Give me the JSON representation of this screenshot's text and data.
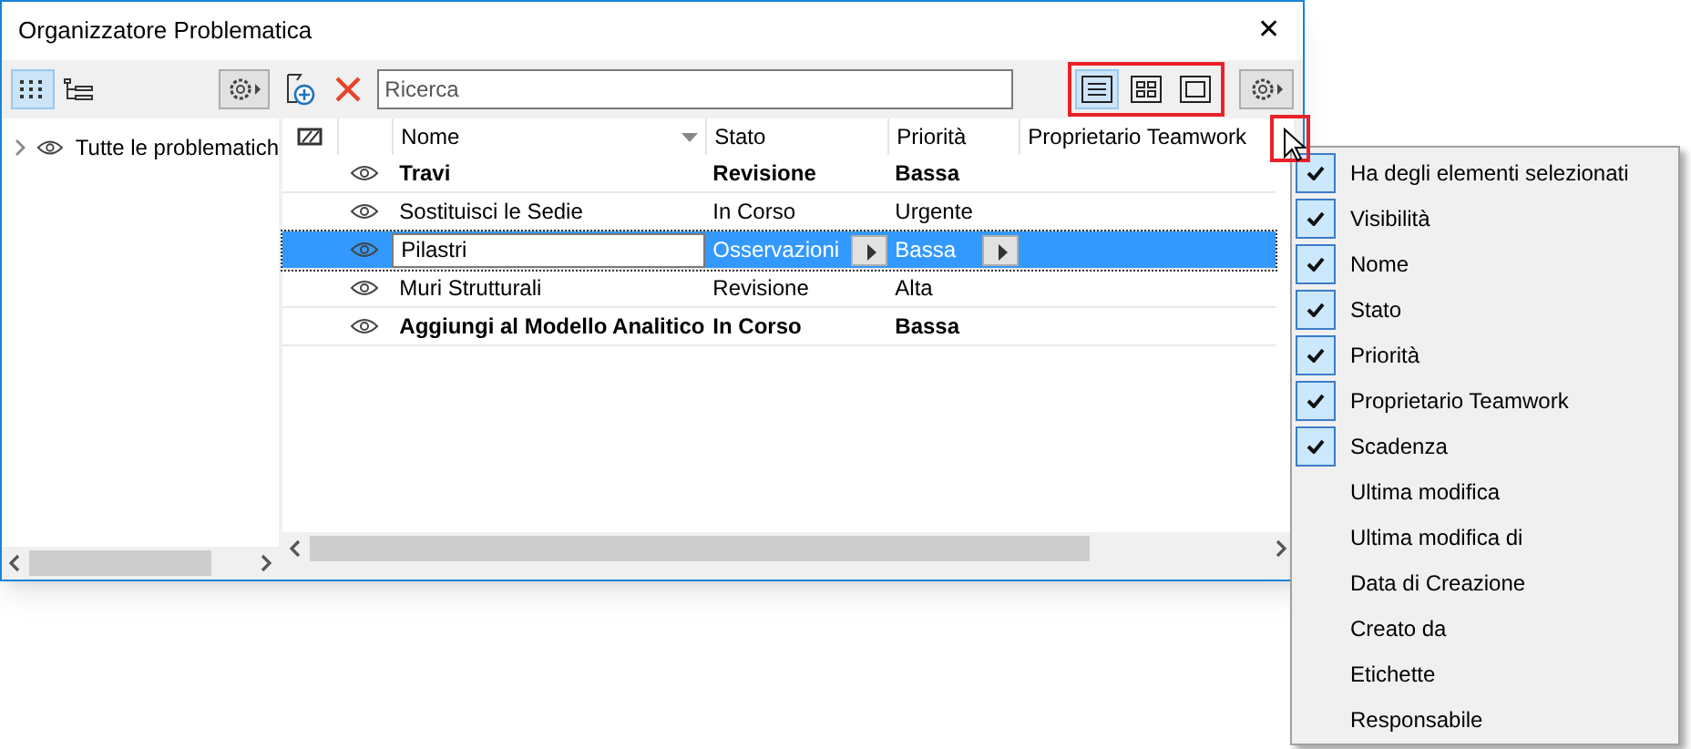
{
  "window": {
    "title": "Organizzatore Problematica",
    "close": "✕"
  },
  "left_panel": {
    "tree": [
      {
        "label": "Tutte le problematich",
        "expanded": false
      }
    ]
  },
  "search": {
    "placeholder": "Ricerca"
  },
  "view_buttons": [
    {
      "kind": "list",
      "selected": true
    },
    {
      "kind": "grid",
      "selected": false
    },
    {
      "kind": "single",
      "selected": false
    }
  ],
  "table": {
    "columns": [
      "Nome",
      "Stato",
      "Priorità",
      "Proprietario Teamwork"
    ],
    "rows": [
      {
        "name": "Travi",
        "status": "Revisione",
        "priority": "Bassa",
        "bold": true,
        "selected": false
      },
      {
        "name": "Sostituisci le Sedie",
        "status": "In Corso",
        "priority": "Urgente",
        "bold": false,
        "selected": false
      },
      {
        "name": "Pilastri",
        "status": "Osservazioni",
        "priority": "Bassa",
        "bold": false,
        "selected": true
      },
      {
        "name": "Muri Strutturali",
        "status": "Revisione",
        "priority": "Alta",
        "bold": false,
        "selected": false
      },
      {
        "name": "Aggiungi al Modello Analitico",
        "status": "In Corso",
        "priority": "Bassa",
        "bold": true,
        "selected": false
      }
    ]
  },
  "column_menu": [
    {
      "label": "Ha degli elementi selezionati",
      "checked": true
    },
    {
      "label": "Visibilità",
      "checked": true
    },
    {
      "label": "Nome",
      "checked": true
    },
    {
      "label": "Stato",
      "checked": true
    },
    {
      "label": "Priorità",
      "checked": true
    },
    {
      "label": "Proprietario Teamwork",
      "checked": true
    },
    {
      "label": "Scadenza",
      "checked": true
    },
    {
      "label": "Ultima modifica",
      "checked": false
    },
    {
      "label": "Ultima modifica di",
      "checked": false
    },
    {
      "label": "Data di Creazione",
      "checked": false
    },
    {
      "label": "Creato da",
      "checked": false
    },
    {
      "label": "Etichette",
      "checked": false
    },
    {
      "label": "Responsabile",
      "checked": false
    }
  ]
}
